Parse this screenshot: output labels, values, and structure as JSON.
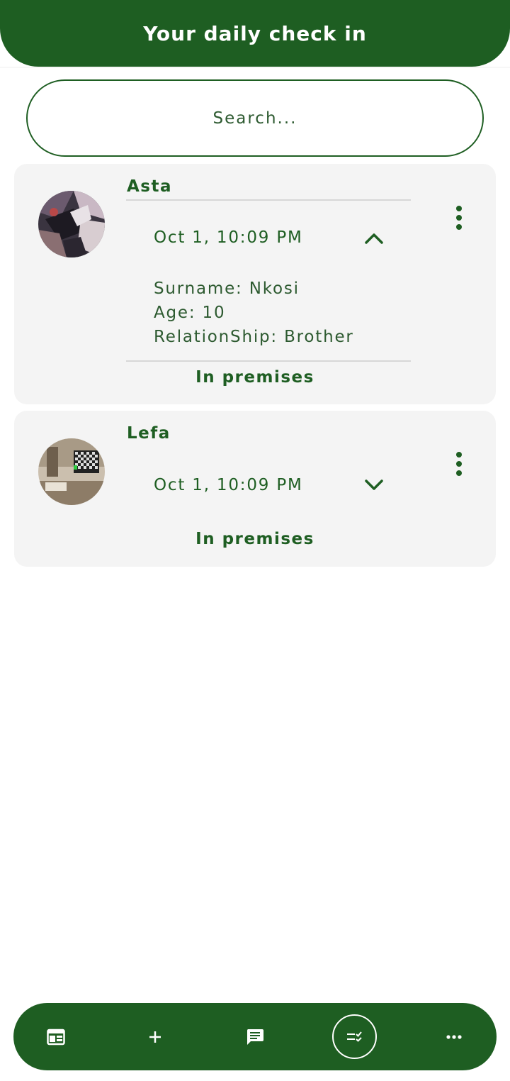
{
  "header": {
    "title": "Your daily check in"
  },
  "search": {
    "placeholder": "Search..."
  },
  "cards": [
    {
      "name": "Asta",
      "datetime": "Oct 1, 10:09 PM",
      "expanded": true,
      "details": {
        "surname": "Surname: Nkosi",
        "age": "Age: 10",
        "relationship": "RelationShip: Brother"
      },
      "status": "In premises"
    },
    {
      "name": "Lefa",
      "datetime": "Oct 1, 10:09 PM",
      "expanded": false,
      "status": "In premises"
    }
  ],
  "bottom_nav": {
    "items": [
      "dashboard-icon",
      "add-icon",
      "message-icon",
      "checklist-icon",
      "more-horizontal-icon"
    ],
    "active": "checklist-icon"
  },
  "colors": {
    "primary": "#1e5e22",
    "card_bg": "#f4f4f4",
    "text": "#2d5a30"
  }
}
